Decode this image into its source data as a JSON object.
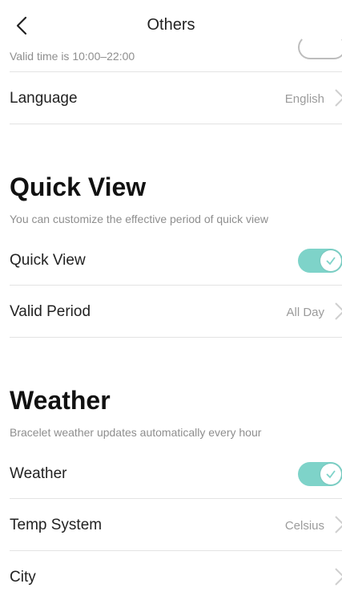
{
  "header": {
    "title": "Others"
  },
  "top": {
    "valid_time": "Valid time is 10:00–22:00"
  },
  "language": {
    "label": "Language",
    "value": "English"
  },
  "quick_view": {
    "section_title": "Quick View",
    "description": "You can customize the effective period of quick view",
    "toggle_label": "Quick View",
    "toggle_on": true,
    "valid_period_label": "Valid Period",
    "valid_period_value": "All Day"
  },
  "weather": {
    "section_title": "Weather",
    "description": "Bracelet weather updates automatically every hour",
    "toggle_label": "Weather",
    "toggle_on": true,
    "temp_system_label": "Temp System",
    "temp_system_value": "Celsius",
    "city_label": "City"
  },
  "colors": {
    "toggle_on": "#7ed3c9",
    "divider": "#e3e3e3",
    "secondary_text": "#8e8e8e"
  }
}
